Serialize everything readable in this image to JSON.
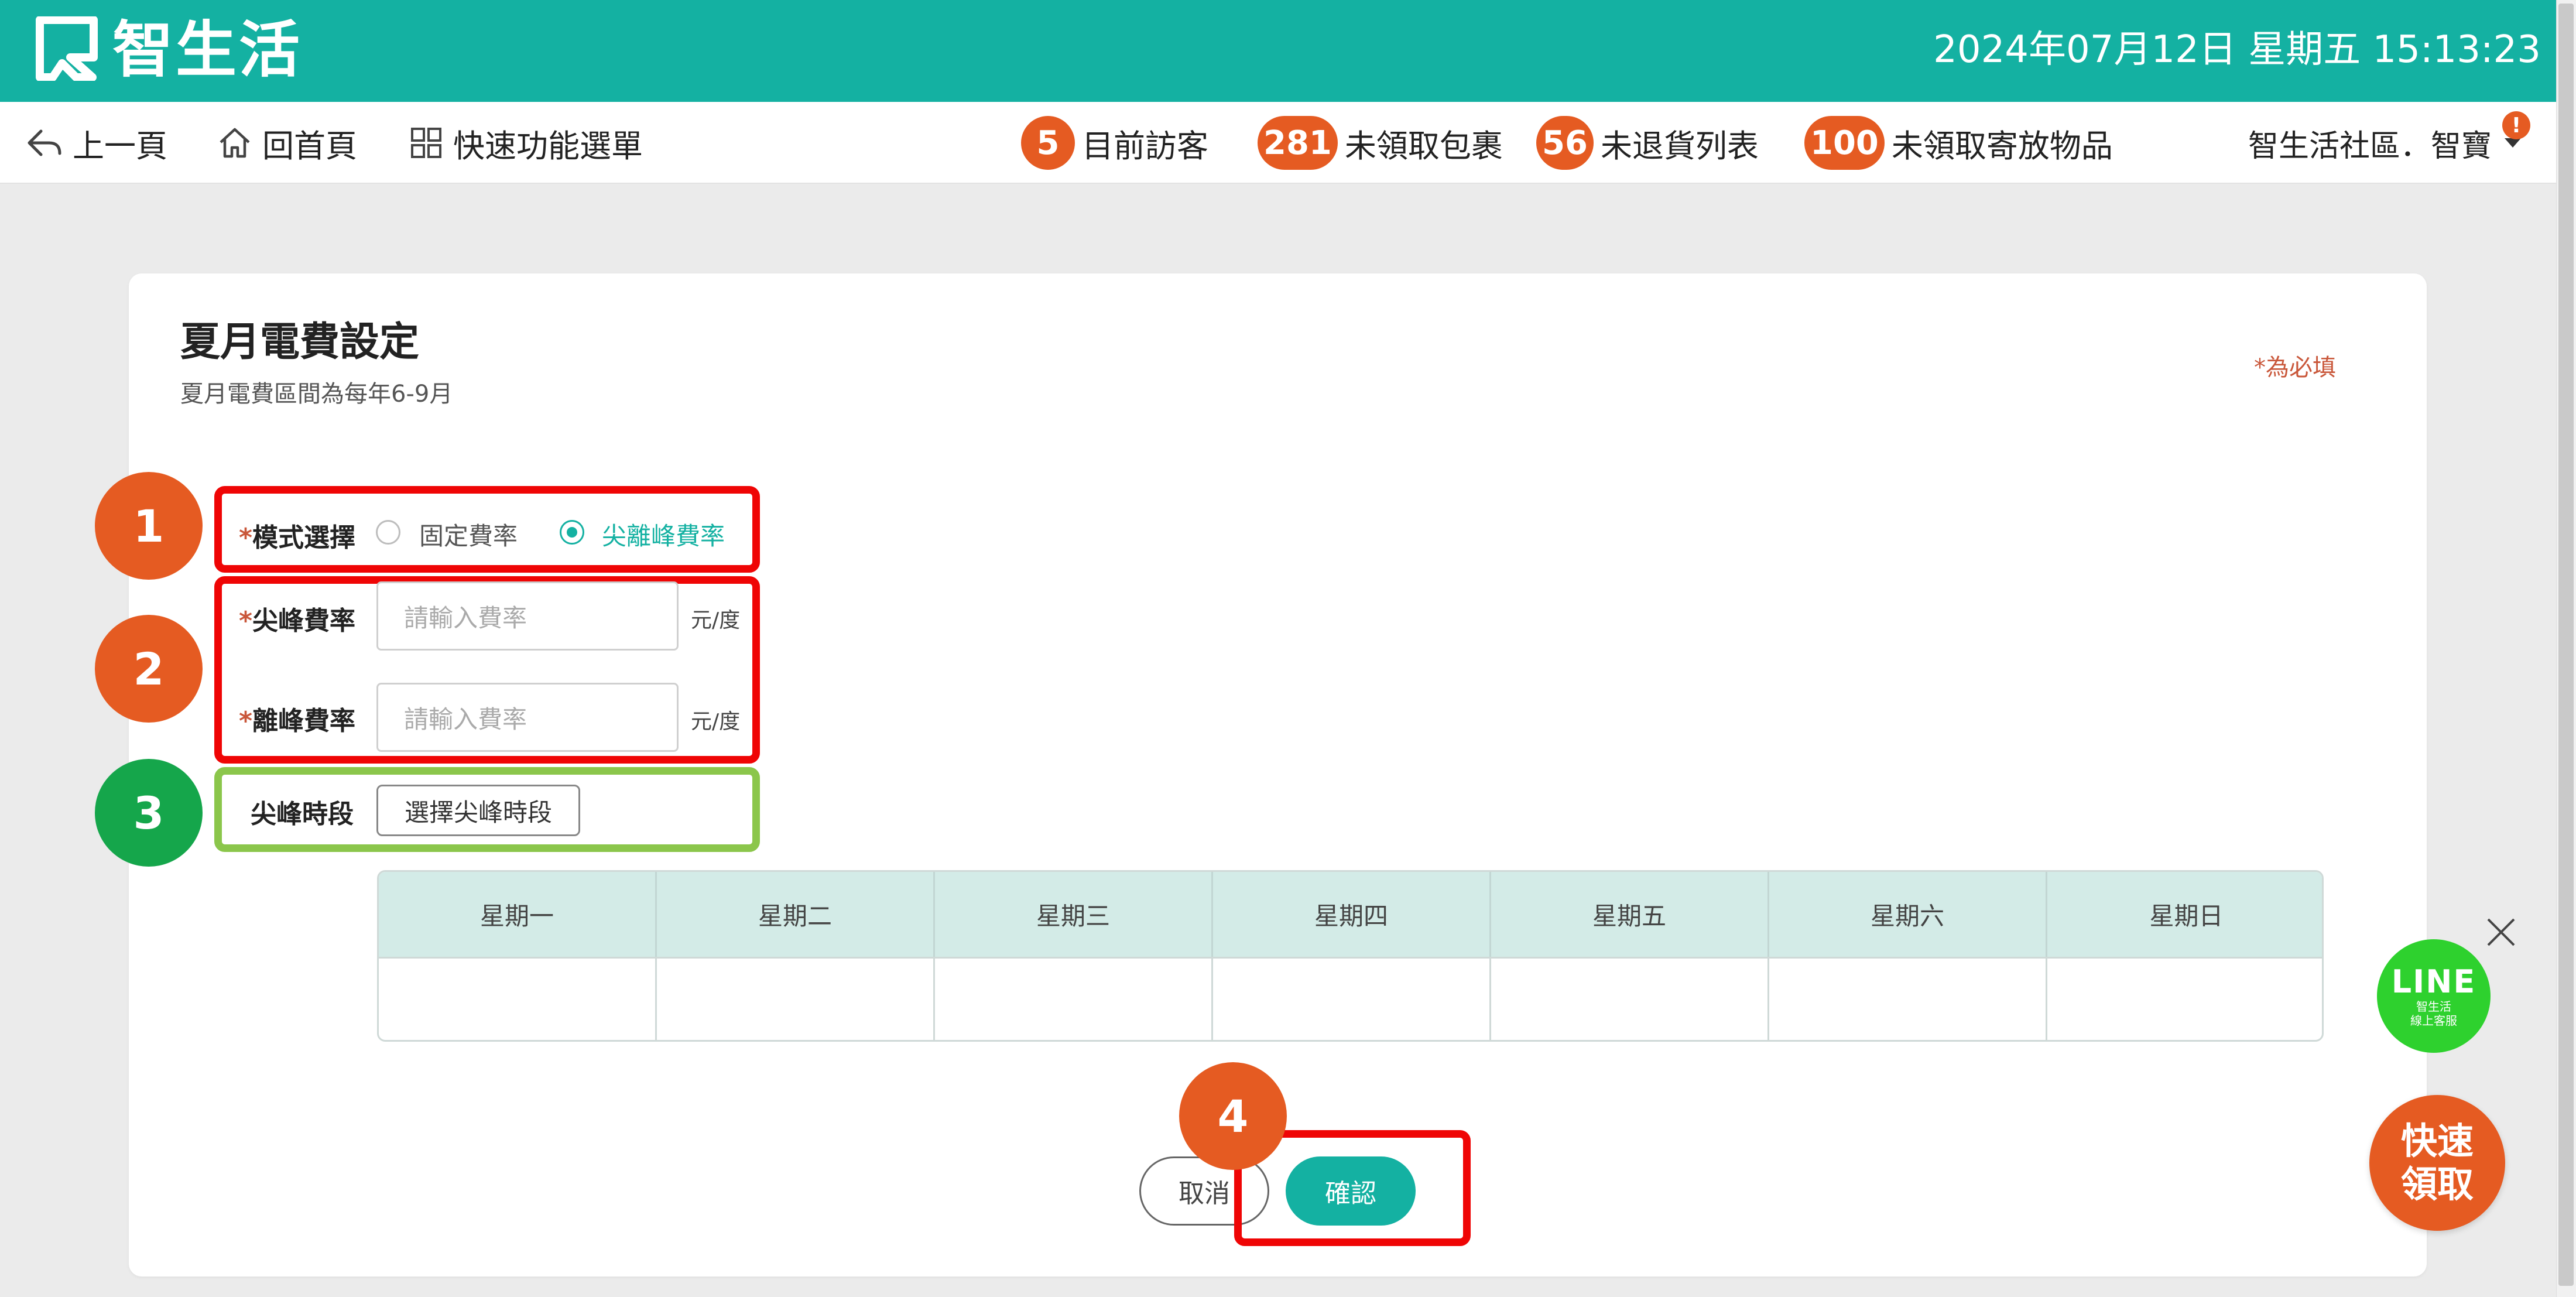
{
  "header": {
    "logo_text": "智生活",
    "datetime": "2024年07月12日 星期五 15:13:23"
  },
  "nav": {
    "back": "上一頁",
    "home": "回首頁",
    "quick_menu": "快速功能選單",
    "visitors_count": "5",
    "visitors_label": "目前訪客",
    "packages_count": "281",
    "packages_label": "未領取包裹",
    "returns_count": "56",
    "returns_label": "未退貨列表",
    "storage_count": "100",
    "storage_label": "未領取寄放物品",
    "user": "智生活社區．智寶",
    "notify": "!"
  },
  "page": {
    "title": "夏月電費設定",
    "subtitle": "夏月電費區間為每年6-9月",
    "required_note": "*為必填"
  },
  "steps": [
    "1",
    "2",
    "3",
    "4"
  ],
  "form": {
    "mode_label": "模式選擇",
    "mode_options": [
      "固定費率",
      "尖離峰費率"
    ],
    "mode_selected": "尖離峰費率",
    "peak_rate_label": "尖峰費率",
    "offpeak_rate_label": "離峰費率",
    "rate_placeholder": "請輸入費率",
    "unit": "元/度",
    "peak_time_label": "尖峰時段",
    "peak_time_button": "選擇尖峰時段",
    "required_mark": "*"
  },
  "week": [
    "星期一",
    "星期二",
    "星期三",
    "星期四",
    "星期五",
    "星期六",
    "星期日"
  ],
  "buttons": {
    "cancel": "取消",
    "confirm": "確認"
  },
  "widgets": {
    "line_title": "LINE",
    "line_sub1": "智生活",
    "line_sub2": "線上客服",
    "quick_line1": "快速",
    "quick_line2": "領取"
  },
  "colors": {
    "brand": "#14b1a2",
    "badge": "#e55b22",
    "highlight_red": "#ef0505",
    "highlight_green": "#8bc64b"
  }
}
